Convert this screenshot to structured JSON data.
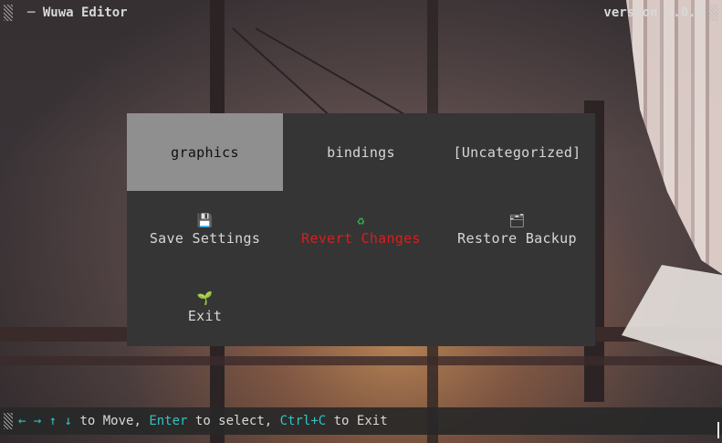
{
  "header": {
    "title": "─ Wuwa Editor",
    "version": "version 1.0.0"
  },
  "tabs": [
    {
      "label": "graphics",
      "selected": true
    },
    {
      "label": "bindings",
      "selected": false
    },
    {
      "label": "[Uncategorized]",
      "selected": false
    }
  ],
  "actions": [
    {
      "label": "Save Settings",
      "icon": "save-icon",
      "glyph": "💾",
      "color": "#d7d7d7"
    },
    {
      "label": "Revert Changes",
      "icon": "recycle-icon",
      "glyph": "♻",
      "color": "#d81e1e"
    },
    {
      "label": "Restore Backup",
      "icon": "backup-icon",
      "glyph": "🗂",
      "color": "#d7d7d7"
    },
    {
      "label": "Exit",
      "icon": "sprout-icon",
      "glyph": "🌱",
      "color": "#d7d7d7"
    }
  ],
  "help_bar": {
    "arrows": "← → ↑ ↓",
    "move_text": " to Move, ",
    "enter_key": "Enter",
    "select_text": " to select, ",
    "ctrl_key": "Ctrl+C",
    "exit_text": " to Exit"
  },
  "colors": {
    "accent": "#2ec4c4",
    "danger": "#d81e1e",
    "selected_bg": "#8f8f8f",
    "panel_bg": "#353535"
  }
}
